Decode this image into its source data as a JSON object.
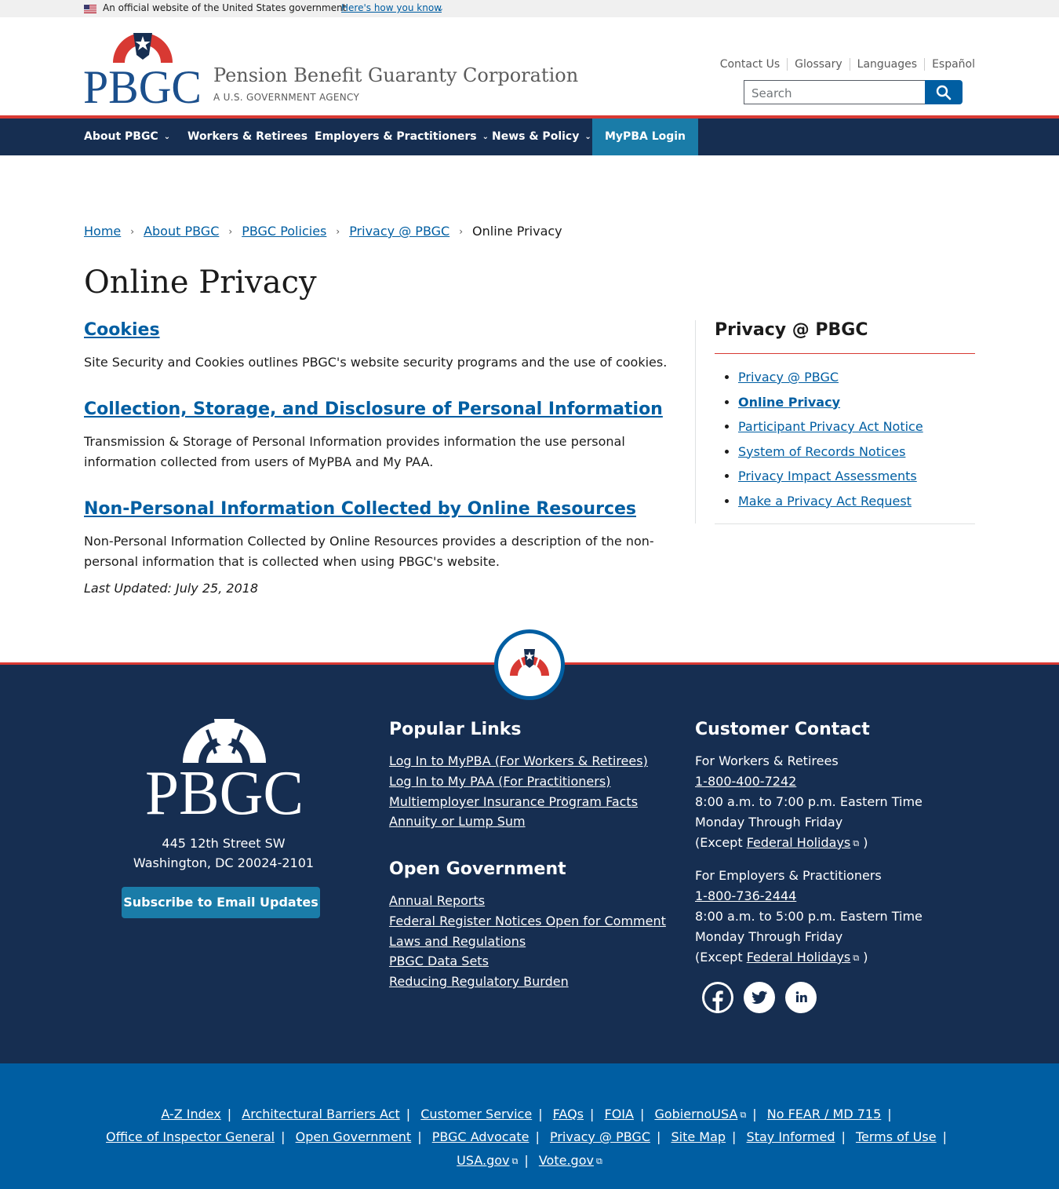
{
  "gov_banner": {
    "official_text": "An official website of the United States government",
    "how_you_know": "Here's how you know"
  },
  "header": {
    "logo_text": "PBGC",
    "site_name": "Pension Benefit Guaranty Corporation",
    "site_subtitle": "A U.S. GOVERNMENT AGENCY",
    "utility_links": [
      "Contact Us",
      "Glossary",
      "Languages",
      "Español"
    ],
    "search_placeholder": "Search"
  },
  "nav": {
    "items": [
      {
        "label": "About PBGC",
        "has_dropdown": true
      },
      {
        "label": "Workers & Retirees",
        "has_dropdown": false
      },
      {
        "label": "Employers & Practitioners",
        "has_dropdown": true
      },
      {
        "label": "News & Policy",
        "has_dropdown": true
      },
      {
        "label": "MyPBA Login",
        "has_dropdown": false
      }
    ]
  },
  "breadcrumb": {
    "items": [
      "Home",
      "About PBGC",
      "PBGC Policies",
      "Privacy @ PBGC"
    ],
    "current": "Online Privacy"
  },
  "page_title": "Online Privacy",
  "sections": [
    {
      "heading": "Cookies",
      "body": "Site Security and Cookies outlines PBGC's website security programs and the use of cookies."
    },
    {
      "heading": "Collection, Storage, and Disclosure of Personal Information",
      "body": "Transmission & Storage of Personal Information provides information the use personal information collected from users of MyPBA and My PAA."
    },
    {
      "heading": "Non-Personal Information Collected by Online Resources",
      "body": "Non-Personal Information Collected by Online Resources provides a description of the non-personal information that is collected when using PBGC's website."
    }
  ],
  "last_updated": "Last Updated: July 25, 2018",
  "sidebar": {
    "title": "Privacy @ PBGC",
    "items": [
      "Privacy @ PBGC",
      "Online Privacy",
      "Participant Privacy Act Notice",
      "System of Records Notices",
      "Privacy Impact Assessments",
      "Make a Privacy Act Request"
    ],
    "active_item": "Online Privacy"
  },
  "footer": {
    "logo_text": "PBGC",
    "address_line1": "445 12th Street SW",
    "address_line2": "Washington, DC 20024-2101",
    "subscribe_label": "Subscribe to Email Updates",
    "popular_links_title": "Popular Links",
    "popular_links": [
      "Log In to MyPBA (For Workers & Retirees)",
      "Log In to My PAA (For Practitioners)",
      "Multiemployer Insurance Program Facts",
      "Annuity or Lump Sum"
    ],
    "open_gov_title": "Open Government",
    "open_gov_links": [
      "Annual Reports",
      "Federal Register Notices Open for Comment",
      "Laws and Regulations",
      "PBGC Data Sets",
      "Reducing Regulatory Burden"
    ],
    "contact_title": "Customer Contact",
    "contacts": [
      {
        "audience": "For Workers & Retirees",
        "phone": "1-800-400-7242",
        "hours": "8:00 a.m. to 7:00 p.m. Eastern Time Monday Through Friday",
        "except_prefix": "(Except",
        "holidays_link": "Federal Holidays",
        "except_suffix": ")"
      },
      {
        "audience": "For Employers & Practitioners",
        "phone": "1-800-736-2444",
        "hours": "8:00 a.m. to 5:00 p.m. Eastern Time Monday Through Friday",
        "except_prefix": "(Except",
        "holidays_link": "Federal Holidays",
        "except_suffix": ")"
      }
    ],
    "social": [
      "facebook-icon",
      "twitter-icon",
      "linkedin-icon"
    ],
    "bottom_links_row1": [
      "A-Z Index",
      "Architectural Barriers Act",
      "Customer Service",
      "FAQs",
      "FOIA",
      "GobiernoUSA",
      "No FEAR / MD 715"
    ],
    "bottom_links_row2": [
      "Office of Inspector General",
      "Open Government",
      "PBGC Advocate",
      "Privacy @ PBGC",
      "Site Map",
      "Stay Informed",
      "Terms of Use"
    ],
    "bottom_links_row3": [
      "USA.gov",
      "Vote.gov"
    ]
  },
  "colors": {
    "primary_blue": "#005ea2",
    "navy": "#162e51",
    "accent_red": "#d83933",
    "teal_button": "#1a7ca8"
  }
}
